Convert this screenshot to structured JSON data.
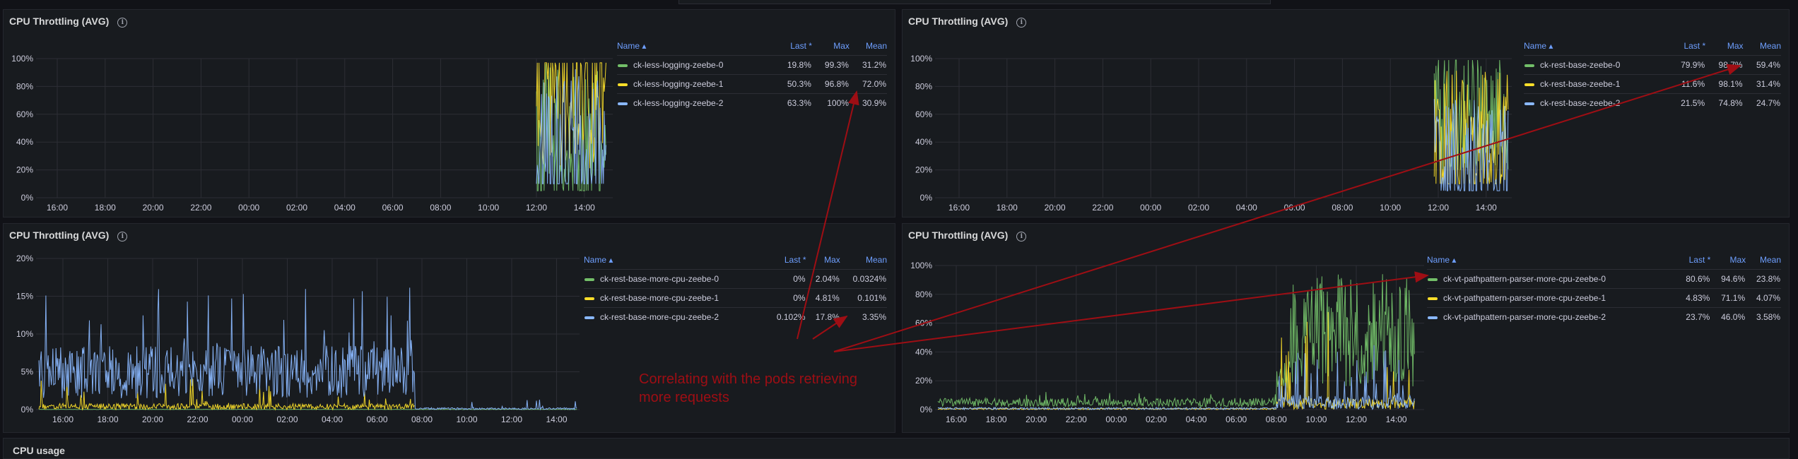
{
  "colors": {
    "green": "#73bf69",
    "yellow": "#fade2a",
    "blue": "#8ab8ff",
    "grid": "#2c2e35",
    "axisText": "#ccccdc",
    "annotation": "#9e0e14"
  },
  "icons": {
    "info": "info-icon"
  },
  "legend_headers": {
    "name": "Name",
    "last": "Last *",
    "max": "Max",
    "mean": "Mean"
  },
  "annotation": {
    "line1": "Correlating with the pods retrieving",
    "line2": "more requests"
  },
  "bottom_panel": {
    "title": "CPU usage"
  },
  "panels": [
    {
      "title": "CPU Throttling (AVG)",
      "legend": [
        {
          "name": "ck-less-logging-zeebe-0",
          "last": "19.8%",
          "max": "99.3%",
          "mean": "31.2%",
          "color": "green"
        },
        {
          "name": "ck-less-logging-zeebe-1",
          "last": "50.3%",
          "max": "96.8%",
          "mean": "72.0%",
          "color": "yellow"
        },
        {
          "name": "ck-less-logging-zeebe-2",
          "last": "63.3%",
          "max": "100%",
          "mean": "30.9%",
          "color": "blue"
        }
      ],
      "chart_data": {
        "type": "line",
        "x_ticks": [
          "16:00",
          "18:00",
          "20:00",
          "22:00",
          "00:00",
          "02:00",
          "04:00",
          "06:00",
          "08:00",
          "10:00",
          "12:00",
          "14:00"
        ],
        "y_ticks": [
          "0%",
          "20%",
          "40%",
          "60%",
          "80%",
          "100%"
        ],
        "ylim": [
          0,
          100
        ],
        "series": [
          {
            "name": "ck-less-logging-zeebe-0",
            "color": "green",
            "start": "12:00",
            "end": "14:55",
            "min": 5,
            "max": 99,
            "typical": 31
          },
          {
            "name": "ck-less-logging-zeebe-1",
            "color": "yellow",
            "start": "12:00",
            "end": "14:55",
            "min": 20,
            "max": 97,
            "typical": 72
          },
          {
            "name": "ck-less-logging-zeebe-2",
            "color": "blue",
            "start": "12:00",
            "end": "14:55",
            "min": 10,
            "max": 100,
            "typical": 31
          }
        ]
      }
    },
    {
      "title": "CPU Throttling (AVG)",
      "legend": [
        {
          "name": "ck-rest-base-zeebe-0",
          "last": "79.9%",
          "max": "98.7%",
          "mean": "59.4%",
          "color": "green"
        },
        {
          "name": "ck-rest-base-zeebe-1",
          "last": "11.6%",
          "max": "98.1%",
          "mean": "31.4%",
          "color": "yellow"
        },
        {
          "name": "ck-rest-base-zeebe-2",
          "last": "21.5%",
          "max": "74.8%",
          "mean": "24.7%",
          "color": "blue"
        }
      ],
      "chart_data": {
        "type": "line",
        "x_ticks": [
          "16:00",
          "18:00",
          "20:00",
          "22:00",
          "00:00",
          "02:00",
          "04:00",
          "06:00",
          "08:00",
          "10:00",
          "12:00",
          "14:00"
        ],
        "y_ticks": [
          "0%",
          "20%",
          "40%",
          "60%",
          "80%",
          "100%"
        ],
        "ylim": [
          0,
          100
        ],
        "series": [
          {
            "name": "ck-rest-base-zeebe-0",
            "color": "green",
            "start": "11:50",
            "end": "14:55",
            "min": 20,
            "max": 99,
            "typical": 59
          },
          {
            "name": "ck-rest-base-zeebe-1",
            "color": "yellow",
            "start": "11:50",
            "end": "14:55",
            "min": 10,
            "max": 98,
            "typical": 31
          },
          {
            "name": "ck-rest-base-zeebe-2",
            "color": "blue",
            "start": "11:50",
            "end": "14:55",
            "min": 5,
            "max": 75,
            "typical": 25
          }
        ]
      }
    },
    {
      "title": "CPU Throttling (AVG)",
      "legend": [
        {
          "name": "ck-rest-base-more-cpu-zeebe-0",
          "last": "0%",
          "max": "2.04%",
          "mean": "0.0324%",
          "color": "green"
        },
        {
          "name": "ck-rest-base-more-cpu-zeebe-1",
          "last": "0%",
          "max": "4.81%",
          "mean": "0.101%",
          "color": "yellow"
        },
        {
          "name": "ck-rest-base-more-cpu-zeebe-2",
          "last": "0.102%",
          "max": "17.8%",
          "mean": "3.35%",
          "color": "blue"
        }
      ],
      "chart_data": {
        "type": "line",
        "x_ticks": [
          "16:00",
          "18:00",
          "20:00",
          "22:00",
          "00:00",
          "02:00",
          "04:00",
          "06:00",
          "08:00",
          "10:00",
          "12:00",
          "14:00"
        ],
        "y_ticks": [
          "0%",
          "5%",
          "10%",
          "15%",
          "20%"
        ],
        "ylim": [
          0,
          20
        ],
        "series": [
          {
            "name": "ck-rest-base-more-cpu-zeebe-0",
            "color": "green",
            "start": "14:55",
            "end": "14:55",
            "min": 0,
            "max": 0.1,
            "typical": 0
          },
          {
            "name": "ck-rest-base-more-cpu-zeebe-1",
            "color": "yellow",
            "start": "14:55",
            "end": "07:40",
            "min": 0,
            "max": 4.8,
            "typical": 0.4
          },
          {
            "name": "ck-rest-base-more-cpu-zeebe-2",
            "color": "blue",
            "start": "14:55",
            "end": "14:55",
            "min": 0,
            "max": 17.8,
            "typical": 5
          }
        ]
      }
    },
    {
      "title": "CPU Throttling (AVG)",
      "legend": [
        {
          "name": "ck-vt-pathpattern-parser-more-cpu-zeebe-0",
          "last": "80.6%",
          "max": "94.6%",
          "mean": "23.8%",
          "color": "green"
        },
        {
          "name": "ck-vt-pathpattern-parser-more-cpu-zeebe-1",
          "last": "4.83%",
          "max": "71.1%",
          "mean": "4.07%",
          "color": "yellow"
        },
        {
          "name": "ck-vt-pathpattern-parser-more-cpu-zeebe-2",
          "last": "23.7%",
          "max": "46.0%",
          "mean": "3.58%",
          "color": "blue"
        }
      ],
      "chart_data": {
        "type": "line",
        "x_ticks": [
          "16:00",
          "18:00",
          "20:00",
          "22:00",
          "00:00",
          "02:00",
          "04:00",
          "06:00",
          "08:00",
          "10:00",
          "12:00",
          "14:00"
        ],
        "y_ticks": [
          "0%",
          "20%",
          "40%",
          "60%",
          "80%",
          "100%"
        ],
        "ylim": [
          0,
          100
        ],
        "series": [
          {
            "name": "ck-vt-pathpattern-parser-more-cpu-zeebe-0",
            "color": "green",
            "start": "14:55",
            "end": "14:55",
            "min": 0,
            "max": 94.6,
            "typical": 23.8
          },
          {
            "name": "ck-vt-pathpattern-parser-more-cpu-zeebe-1",
            "color": "yellow",
            "start": "08:00",
            "end": "14:55",
            "min": 0,
            "max": 71,
            "typical": 4
          },
          {
            "name": "ck-vt-pathpattern-parser-more-cpu-zeebe-2",
            "color": "blue",
            "start": "08:00",
            "end": "14:55",
            "min": 0,
            "max": 46,
            "typical": 3.6
          }
        ]
      }
    }
  ]
}
